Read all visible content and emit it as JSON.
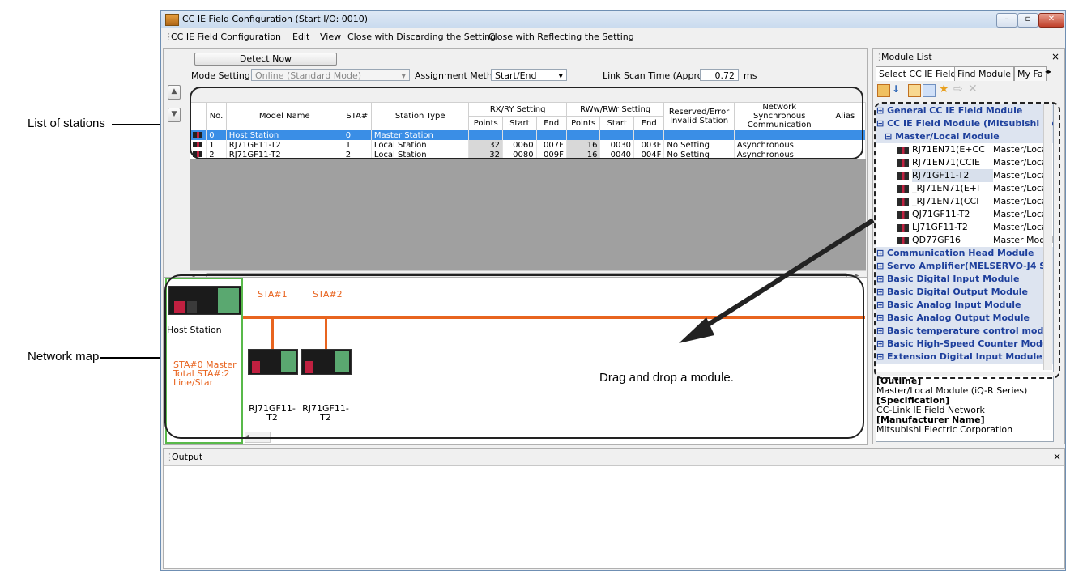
{
  "callouts": {
    "list_of_stations": "List of stations",
    "network_map": "Network map"
  },
  "window": {
    "title": "CC IE Field Configuration (Start I/O: 0010)",
    "controls": {
      "minimize": "–",
      "maximize": "▫",
      "close": "✕"
    }
  },
  "menu": {
    "items": [
      "CC IE Field Configuration",
      "Edit",
      "View",
      "Close with Discarding the Setting",
      "Close with Reflecting the Setting"
    ]
  },
  "toolbar": {
    "detect_now": "Detect Now",
    "mode_setting_label": "Mode Setting:",
    "mode_setting_value": "Online (Standard Mode)",
    "assignment_method_label": "Assignment Method:",
    "assignment_method_value": "Start/End",
    "link_scan_label": "Link Scan Time (Approx.):",
    "link_scan_value": "0.72",
    "link_scan_unit": "ms"
  },
  "table": {
    "headers": {
      "no": "No.",
      "model_name": "Model Name",
      "sta": "STA#",
      "station_type": "Station Type",
      "rx_ry": "RX/RY Setting",
      "rww_rwr": "RWw/RWr Setting",
      "points": "Points",
      "start": "Start",
      "end": "End",
      "reserved": "Reserved/Error Invalid Station",
      "network_sync": "Network Synchronous Communication",
      "alias": "Alias"
    },
    "rows": [
      {
        "no": "0",
        "model": "Host Station",
        "sta": "0",
        "type": "Master Station",
        "rx_points": "",
        "rx_start": "",
        "rx_end": "",
        "rw_points": "",
        "rw_start": "",
        "rw_end": "",
        "reserved": "",
        "sync": ""
      },
      {
        "no": "1",
        "model": "RJ71GF11-T2",
        "sta": "1",
        "type": "Local Station",
        "rx_points": "32",
        "rx_start": "0060",
        "rx_end": "007F",
        "rw_points": "16",
        "rw_start": "0030",
        "rw_end": "003F",
        "reserved": "No Setting",
        "sync": "Asynchronous"
      },
      {
        "no": "2",
        "model": "RJ71GF11-T2",
        "sta": "2",
        "type": "Local Station",
        "rx_points": "32",
        "rx_start": "0080",
        "rx_end": "009F",
        "rw_points": "16",
        "rw_start": "0040",
        "rw_end": "004F",
        "reserved": "No Setting",
        "sync": "Asynchronous"
      }
    ]
  },
  "network_map": {
    "host_label": "Host Station",
    "host_info": [
      "STA#0  Master",
      "Total STA#:2",
      "Line/Star"
    ],
    "stations": [
      {
        "tag": "STA#1",
        "label1": "RJ71GF11-",
        "label2": "T2"
      },
      {
        "tag": "STA#2",
        "label1": "RJ71GF11-",
        "label2": "T2"
      }
    ],
    "drag_hint": "Drag and drop a module."
  },
  "module_list": {
    "title": "Module List",
    "close": "×",
    "tabs": [
      "Select CC IE Field",
      "Find Module",
      "My Fa"
    ],
    "categories_top": [
      {
        "label": "General CC IE Field Module",
        "expander": "⊞"
      },
      {
        "label": "CC IE Field Module (Mitsubishi Elec",
        "expander": "⊟"
      }
    ],
    "subcategory": {
      "label": "Master/Local Module",
      "expander": "⊟"
    },
    "modules": [
      {
        "name": "RJ71EN71(E+CC",
        "type": "Master/Local Mo"
      },
      {
        "name": "RJ71EN71(CCIE",
        "type": "Master/Local Mo"
      },
      {
        "name": "RJ71GF11-T2",
        "type": "Master/Local Mo"
      },
      {
        "name": "_RJ71EN71(E+I",
        "type": "Master/Local Mo"
      },
      {
        "name": "_RJ71EN71(CCI",
        "type": "Master/Local Mo"
      },
      {
        "name": "QJ71GF11-T2",
        "type": "Master/Local Mo"
      },
      {
        "name": "LJ71GF11-T2",
        "type": "Master/Local Mo"
      },
      {
        "name": "QD77GF16",
        "type": "Master Module"
      }
    ],
    "categories_bottom": [
      "Communication Head Module",
      "Servo Amplifier(MELSERVO-J4 S",
      "Basic Digital Input Module",
      "Basic Digital Output Module",
      "Basic Analog Input Module",
      "Basic Analog Output Module",
      "Basic temperature control modu",
      "Basic High-Speed Counter Modu",
      "Extension Digital Input Module"
    ],
    "outline": {
      "outline_label": "[Outline]",
      "outline_text": "Master/Local Module (iQ-R Series)",
      "spec_label": "[Specification]",
      "spec_text": "CC-Link IE Field Network",
      "mfr_label": "[Manufacturer Name]",
      "mfr_text": "Mitsubishi Electric Corporation"
    }
  },
  "output": {
    "title": "Output",
    "close": "×"
  }
}
